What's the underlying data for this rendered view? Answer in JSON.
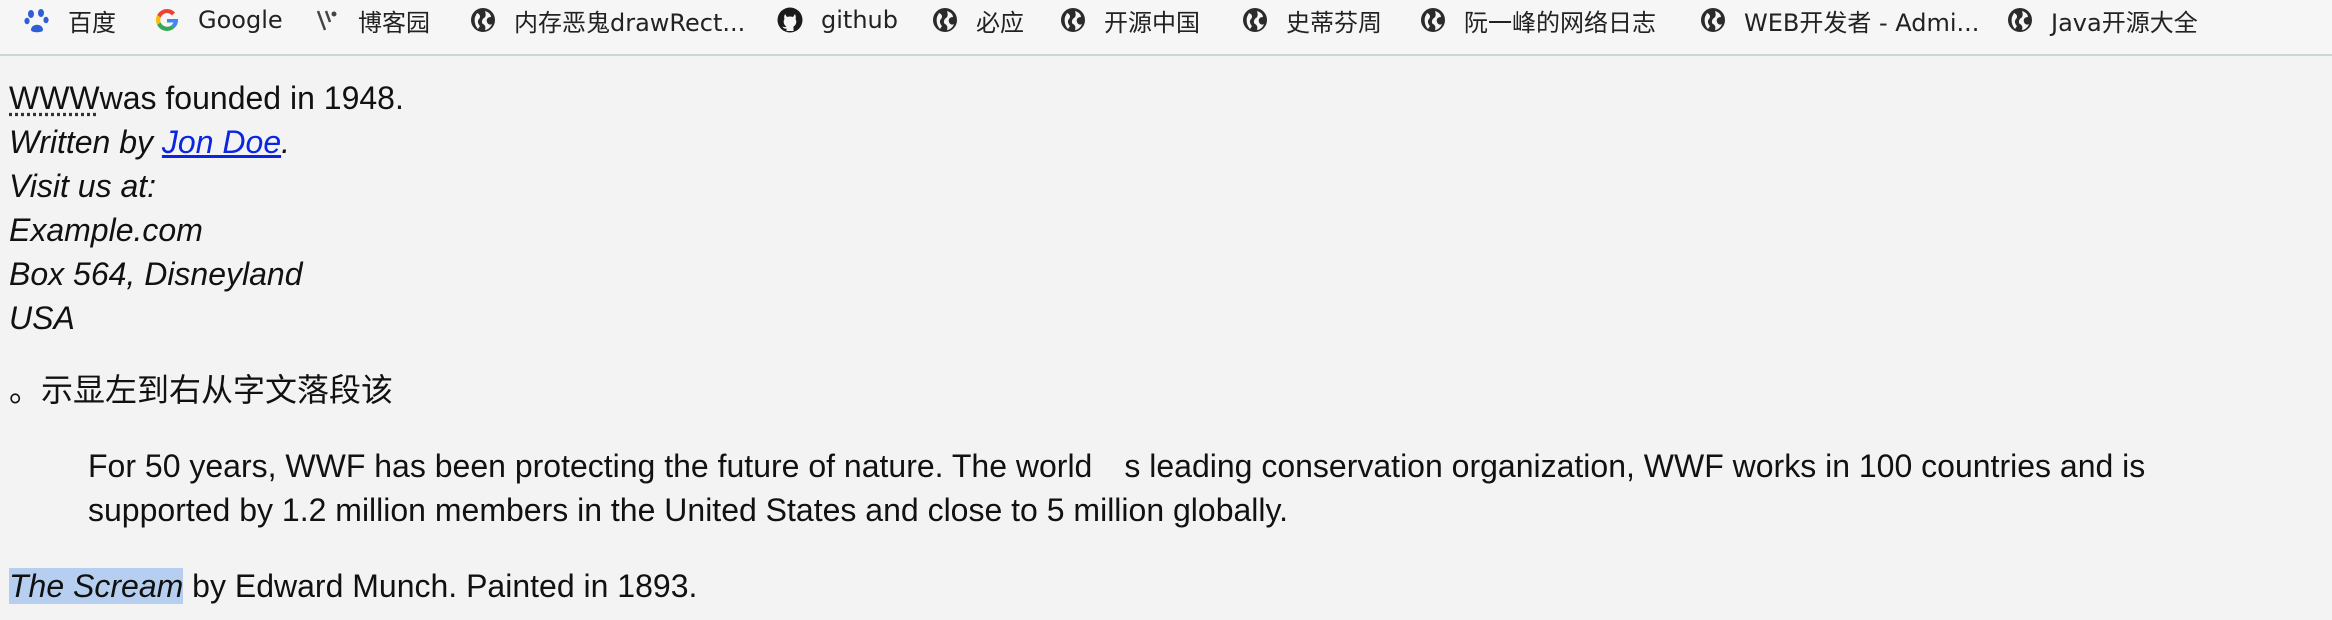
{
  "bookmarks": [
    {
      "label": "百度",
      "icon": "baidu-paw-icon"
    },
    {
      "label": "Google",
      "icon": "google-g-icon"
    },
    {
      "label": "博客园",
      "icon": "cnblogs-icon"
    },
    {
      "label": "内存恶鬼drawRect...",
      "icon": "globe-icon"
    },
    {
      "label": "github",
      "icon": "github-octocat-icon"
    },
    {
      "label": "必应",
      "icon": "globe-icon"
    },
    {
      "label": "开源中国",
      "icon": "globe-icon"
    },
    {
      "label": "史蒂芬周",
      "icon": "globe-icon"
    },
    {
      "label": "阮一峰的网络日志",
      "icon": "globe-icon"
    },
    {
      "label": "WEB开发者 - Admi...",
      "icon": "globe-icon"
    },
    {
      "label": "Java开源大全",
      "icon": "globe-icon"
    }
  ],
  "content": {
    "abbr": "WWW",
    "founded": "was founded in 1948.",
    "written_prefix": "Written by ",
    "author": "Jon Doe",
    "written_suffix": ".",
    "visit": "Visit us at:",
    "address": [
      "Example.com",
      "Box 564, Disneyland",
      "USA"
    ],
    "rtl_text": "。示显左到右从字文落段该",
    "quote": "For 50 years, WWF has been protecting the future of nature. The world s leading conservation organization, WWF works in 100 countries and is supported by 1.2 million members in the United States and close to 5 million globally.",
    "scream_title": "The Scream",
    "scream_rest": " by Edward Munch. Painted in 1893."
  },
  "colors": {
    "link": "#0b26e0",
    "selection": "#b6cff0",
    "bookmark_bar_border": "#c9d6d2"
  }
}
